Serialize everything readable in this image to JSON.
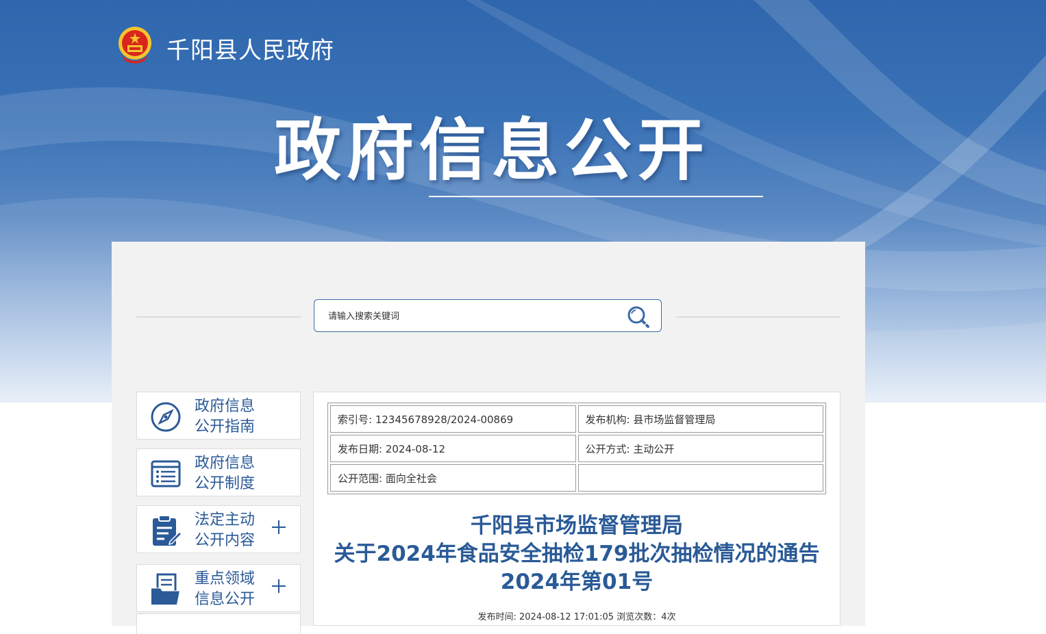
{
  "header": {
    "site_name": "千阳县人民政府",
    "hero_title": "政府信息公开",
    "logo_icon": "national-emblem-icon"
  },
  "search": {
    "placeholder": "请输入搜索关键词",
    "button_icon": "search-icon"
  },
  "sidebar": {
    "items": [
      {
        "label_line1": "政府信息",
        "label_line2": "公开指南",
        "icon": "compass-icon",
        "expandable": false
      },
      {
        "label_line1": "政府信息",
        "label_line2": "公开制度",
        "icon": "list-icon",
        "expandable": false
      },
      {
        "label_line1": "法定主动",
        "label_line2": "公开内容",
        "icon": "clipboard-edit-icon",
        "expandable": true
      },
      {
        "label_line1": "重点领域",
        "label_line2": "信息公开",
        "icon": "folder-document-icon",
        "expandable": true
      }
    ]
  },
  "meta": {
    "index_no": "索引号: 12345678928/2024-00869",
    "publisher": "发布机构: 县市场监督管理局",
    "publish_date": "发布日期: 2024-08-12",
    "disclosure_mode": "公开方式: 主动公开",
    "disclosure_scope": "公开范围: 面向全社会"
  },
  "article": {
    "title_line1": "千阳县市场监督管理局",
    "title_line2": "关于2024年食品安全抽检179批次抽检情况的通告",
    "title_line3": "2024年第01号",
    "publish_info": "发布时间: 2024-08-12 17:01:05 浏览次数：4次"
  },
  "colors": {
    "accent": "#2a5a97",
    "banner": "#2f66ad"
  }
}
